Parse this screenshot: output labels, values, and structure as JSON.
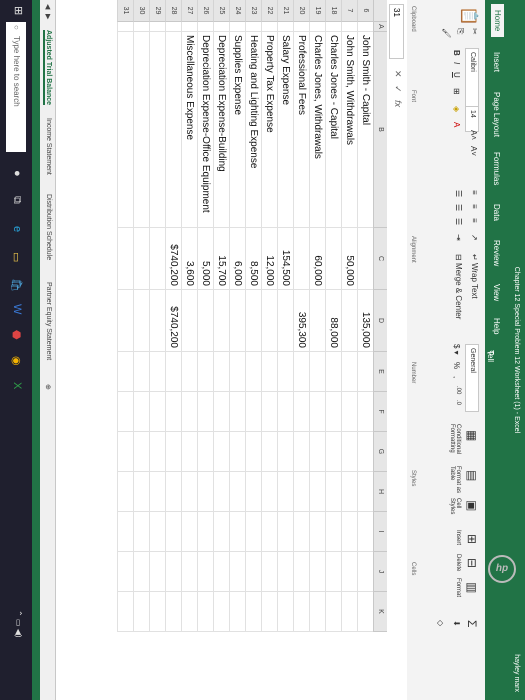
{
  "window": {
    "title": "Chapter 12 Special Problem 12 Worksheet (1) - Excel",
    "user": "hayley marx"
  },
  "ribbon_tabs": [
    "Home",
    "Insert",
    "Page Layout",
    "Formulas",
    "Data",
    "Review",
    "View",
    "Help"
  ],
  "tell_me": "Tell me what you want to do",
  "ribbon": {
    "font_name": "Calibri",
    "font_size": "14",
    "wrap_text": "Wrap Text",
    "merge_center": "Merge & Center",
    "number_format": "General",
    "conditional_formatting": "Conditional Formatting",
    "format_as_table": "Format as Table",
    "cell_styles": "Cell Styles",
    "insert": "Insert",
    "delete": "Delete",
    "format": "Format",
    "groups": {
      "clipboard": "Clipboard",
      "font": "Font",
      "alignment": "Alignment",
      "number": "Number",
      "styles": "Styles",
      "cells": "Cells"
    }
  },
  "formula_bar": {
    "name_box": "31",
    "fx": "fx"
  },
  "columns": [
    "A",
    "B",
    "C",
    "D",
    "E",
    "F",
    "G",
    "H",
    "I",
    "J",
    "K"
  ],
  "rows": [
    {
      "num": "6",
      "label": "John Smith - Capital",
      "c": "",
      "d": "135,000"
    },
    {
      "num": "7",
      "label": "John Smith, Withdrawals",
      "c": "50,000",
      "d": ""
    },
    {
      "num": "18",
      "label": "Charles Jones - Capital",
      "c": "",
      "d": "88,000"
    },
    {
      "num": "19",
      "label": "Charles Jones, Withdrawals",
      "c": "60,000",
      "d": ""
    },
    {
      "num": "20",
      "label": "Professional Fees",
      "c": "",
      "d": "395,300"
    },
    {
      "num": "21",
      "label": "Salary Expense",
      "c": "154,500",
      "d": ""
    },
    {
      "num": "22",
      "label": "Property Tax Expense",
      "c": "12,000",
      "d": ""
    },
    {
      "num": "23",
      "label": "Heating and Lighting Expense",
      "c": "8,500",
      "d": ""
    },
    {
      "num": "24",
      "label": "Supplies Expense",
      "c": "6,000",
      "d": ""
    },
    {
      "num": "25",
      "label": "Depreciation Expense-Building",
      "c": "15,700",
      "d": ""
    },
    {
      "num": "26",
      "label": "Depreciation Expense-Office Equipment",
      "c": "5,000",
      "d": ""
    },
    {
      "num": "27",
      "label": "Miscellaneous Expense",
      "c": "3,600",
      "d": ""
    },
    {
      "num": "28",
      "label": "",
      "c": "$740,200",
      "d": "$740,200"
    },
    {
      "num": "29",
      "label": "",
      "c": "",
      "d": ""
    },
    {
      "num": "30",
      "label": "",
      "c": "",
      "d": ""
    },
    {
      "num": "31",
      "label": "",
      "c": "",
      "d": ""
    }
  ],
  "sheet_tabs": [
    "Adjusted Trial Balance",
    "Income Statement",
    "Distribution Schedule",
    "Partner Equity Statement"
  ],
  "taskbar": {
    "search_placeholder": "Type here to search"
  },
  "colors": {
    "excel_green": "#217346",
    "taskbar": "#1f1f2e"
  }
}
